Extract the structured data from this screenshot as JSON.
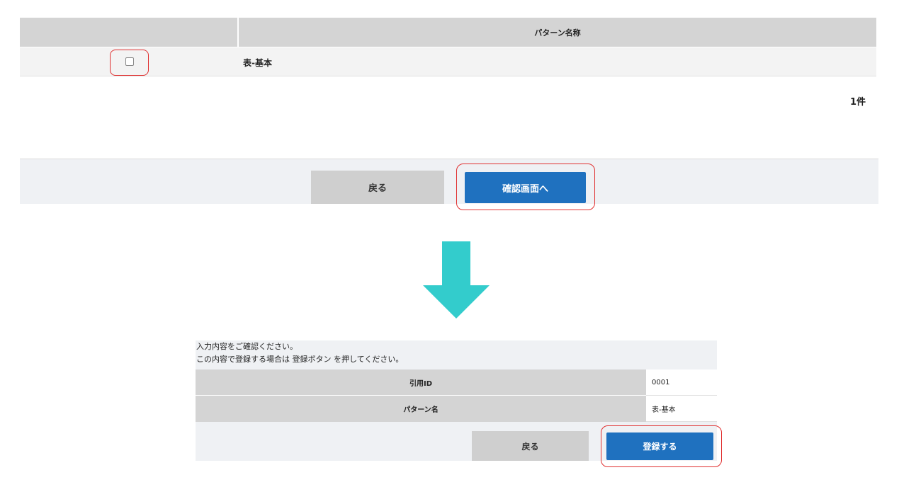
{
  "list_screen": {
    "column_header": "パターン名称",
    "rows": [
      {
        "name": "表-基本",
        "checked": false
      }
    ],
    "count_label": "1件",
    "back_label": "戻る",
    "confirm_label": "確認画面へ"
  },
  "arrow": {
    "color": "#33cccc",
    "icon": "down-arrow-icon"
  },
  "confirm_screen": {
    "message_line1": "入力内容をご確認ください。",
    "message_line2": "この内容で登録する場合は 登録ボタン を押してください。",
    "fields": [
      {
        "label": "引用ID",
        "value": "0001"
      },
      {
        "label": "パターン名",
        "value": "表-基本"
      }
    ],
    "back_label": "戻る",
    "register_label": "登録する"
  },
  "colors": {
    "primary_button": "#1f71bf",
    "highlight": "#e03030",
    "header_gray": "#d4d4d4"
  }
}
